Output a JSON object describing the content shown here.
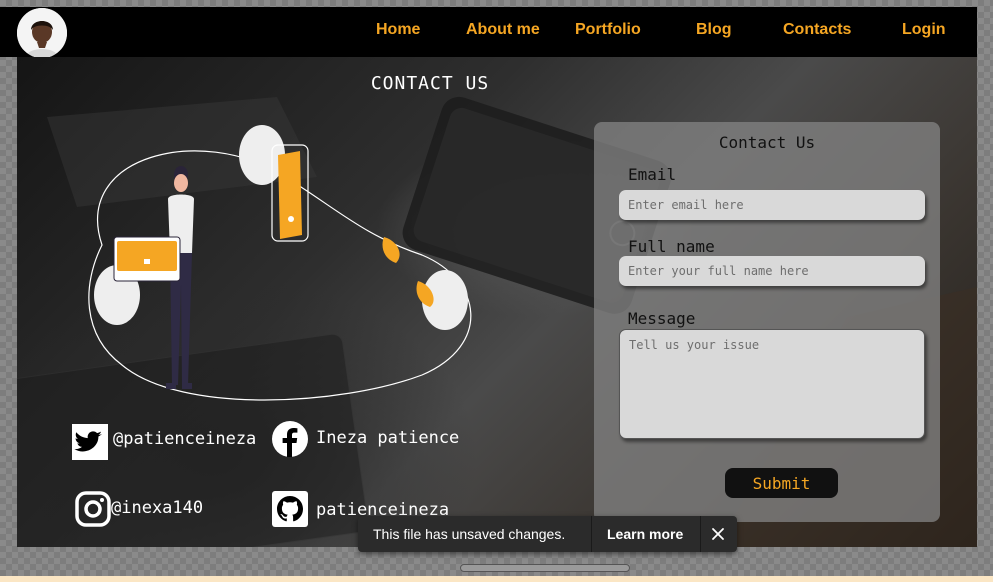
{
  "nav": {
    "items": [
      {
        "label": "Home"
      },
      {
        "label": "About me"
      },
      {
        "label": "Portfolio"
      },
      {
        "label": "Blog"
      },
      {
        "label": "Contacts"
      },
      {
        "label": "Login"
      }
    ],
    "accent_color": "#f5a623"
  },
  "page": {
    "title": "CONTACT US"
  },
  "form": {
    "title": "Contact Us",
    "email_label": "Email",
    "email_placeholder": "Enter email here",
    "name_label": "Full name",
    "name_placeholder": "Enter your full name here",
    "message_label": "Message",
    "message_placeholder": "Tell us your issue",
    "submit_label": "Submit"
  },
  "socials": {
    "twitter": {
      "icon": "twitter-icon",
      "handle": "@patienceineza"
    },
    "facebook": {
      "icon": "facebook-icon",
      "handle": "Ineza patience"
    },
    "instagram": {
      "icon": "instagram-icon",
      "handle": "@inexa140"
    },
    "github": {
      "icon": "github-icon",
      "handle": "patienceineza"
    }
  },
  "toast": {
    "message": "This file has unsaved changes.",
    "link_label": "Learn more"
  }
}
